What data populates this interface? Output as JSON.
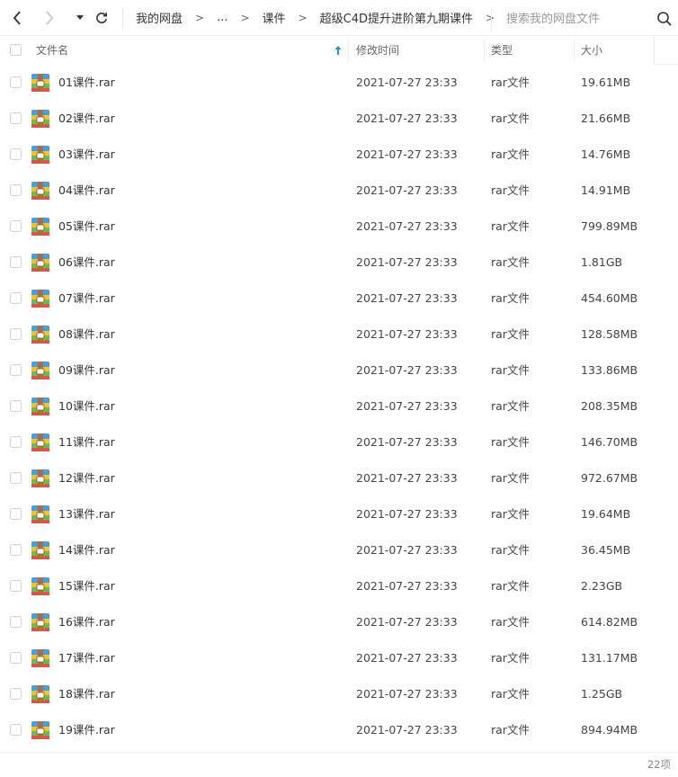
{
  "breadcrumb": {
    "items": [
      "我的网盘",
      "...",
      "课件",
      "超级C4D提升进阶第九期课件"
    ],
    "separator": ">"
  },
  "search": {
    "placeholder": "搜索我的网盘文件"
  },
  "table": {
    "columns": {
      "name": "文件名",
      "modified": "修改时间",
      "type": "类型",
      "size": "大小"
    },
    "rows": [
      {
        "name": "01课件.rar",
        "modified": "2021-07-27 23:33",
        "type": "rar文件",
        "size": "19.61MB"
      },
      {
        "name": "02课件.rar",
        "modified": "2021-07-27 23:33",
        "type": "rar文件",
        "size": "21.66MB"
      },
      {
        "name": "03课件.rar",
        "modified": "2021-07-27 23:33",
        "type": "rar文件",
        "size": "14.76MB"
      },
      {
        "name": "04课件.rar",
        "modified": "2021-07-27 23:33",
        "type": "rar文件",
        "size": "14.91MB"
      },
      {
        "name": "05课件.rar",
        "modified": "2021-07-27 23:33",
        "type": "rar文件",
        "size": "799.89MB"
      },
      {
        "name": "06课件.rar",
        "modified": "2021-07-27 23:33",
        "type": "rar文件",
        "size": "1.81GB"
      },
      {
        "name": "07课件.rar",
        "modified": "2021-07-27 23:33",
        "type": "rar文件",
        "size": "454.60MB"
      },
      {
        "name": "08课件.rar",
        "modified": "2021-07-27 23:33",
        "type": "rar文件",
        "size": "128.58MB"
      },
      {
        "name": "09课件.rar",
        "modified": "2021-07-27 23:33",
        "type": "rar文件",
        "size": "133.86MB"
      },
      {
        "name": "10课件.rar",
        "modified": "2021-07-27 23:33",
        "type": "rar文件",
        "size": "208.35MB"
      },
      {
        "name": "11课件.rar",
        "modified": "2021-07-27 23:33",
        "type": "rar文件",
        "size": "146.70MB"
      },
      {
        "name": "12课件.rar",
        "modified": "2021-07-27 23:33",
        "type": "rar文件",
        "size": "972.67MB"
      },
      {
        "name": "13课件.rar",
        "modified": "2021-07-27 23:33",
        "type": "rar文件",
        "size": "19.64MB"
      },
      {
        "name": "14课件.rar",
        "modified": "2021-07-27 23:33",
        "type": "rar文件",
        "size": "36.45MB"
      },
      {
        "name": "15课件.rar",
        "modified": "2021-07-27 23:33",
        "type": "rar文件",
        "size": "2.23GB"
      },
      {
        "name": "16课件.rar",
        "modified": "2021-07-27 23:33",
        "type": "rar文件",
        "size": "614.82MB"
      },
      {
        "name": "17课件.rar",
        "modified": "2021-07-27 23:33",
        "type": "rar文件",
        "size": "131.17MB"
      },
      {
        "name": "18课件.rar",
        "modified": "2021-07-27 23:33",
        "type": "rar文件",
        "size": "1.25GB"
      },
      {
        "name": "19课件.rar",
        "modified": "2021-07-27 23:33",
        "type": "rar文件",
        "size": "894.94MB"
      }
    ]
  },
  "footer": {
    "count": "22项"
  },
  "icons": {
    "back": "chevron-left-icon",
    "forward": "chevron-right-icon",
    "history": "caret-down-icon",
    "refresh": "refresh-icon",
    "search": "search-icon",
    "sort": "sort-up-icon",
    "file": "rar-archive-icon"
  },
  "colors": {
    "sort_arrow": "#2f8bd8",
    "archive_blue": "#4a9be0",
    "archive_yellow": "#f2c230",
    "archive_green": "#6cbf4a",
    "archive_red": "#e0524a"
  }
}
